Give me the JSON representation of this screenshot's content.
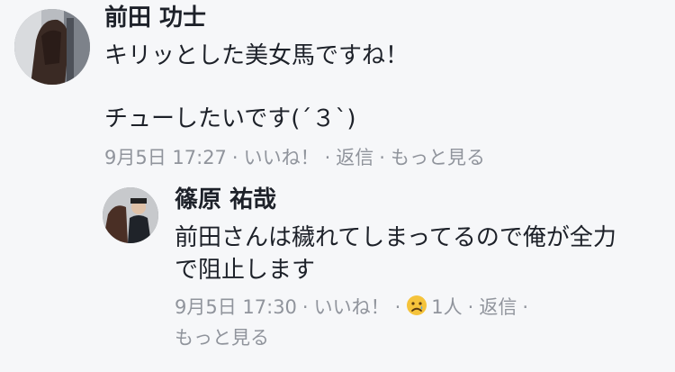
{
  "comment1": {
    "author": "前田 功士",
    "line1": "キリッとした美女馬ですね！",
    "line2": "チューしたいです(´３`)",
    "timestamp": "9月5日 17:27",
    "like": "いいね！",
    "reply": "返信",
    "more": "もっと見る"
  },
  "reply1": {
    "author": "篠原 祐哉",
    "line1": "前田さんは穢れてしまってるので俺が全力",
    "line2": "で阻止します",
    "timestamp": "9月5日 17:30",
    "like": "いいね！",
    "reaction_count": "1人",
    "reply": "返信",
    "more": "もっと見る"
  },
  "meta_separator": "·",
  "colors": {
    "background": "#f6f7f9",
    "text": "#1d2129",
    "meta": "#90949c",
    "emoji": "#f5c33b"
  },
  "icons": {
    "reaction": "sad-emoji-icon"
  }
}
